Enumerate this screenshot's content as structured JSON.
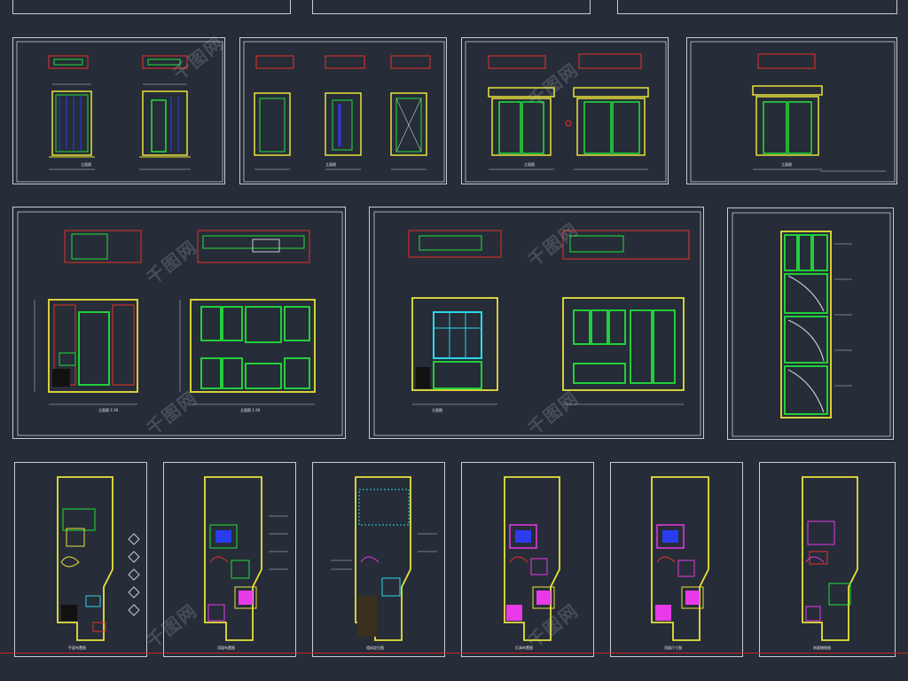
{
  "drawing_set": {
    "watermark": "千图网",
    "row1_titles": [
      "立面图",
      "立面图",
      "立面图",
      "立面图"
    ],
    "row2_titles": [
      "立面图 1:30",
      "立面图 1:30",
      "立面图"
    ],
    "row3_titles": [
      "平面布置图",
      "顶面布置图",
      "墙体定位图",
      "灯具布置图",
      "顶面尺寸图",
      "地面铺装图"
    ]
  },
  "colors": {
    "background": "#262c38",
    "frame": "#c9ccd2",
    "green": "#22e03a",
    "yellow": "#e8e23a",
    "red": "#e83228",
    "cyan": "#2ad8e8",
    "blue": "#2a3cf0",
    "magenta": "#e83ae8"
  }
}
